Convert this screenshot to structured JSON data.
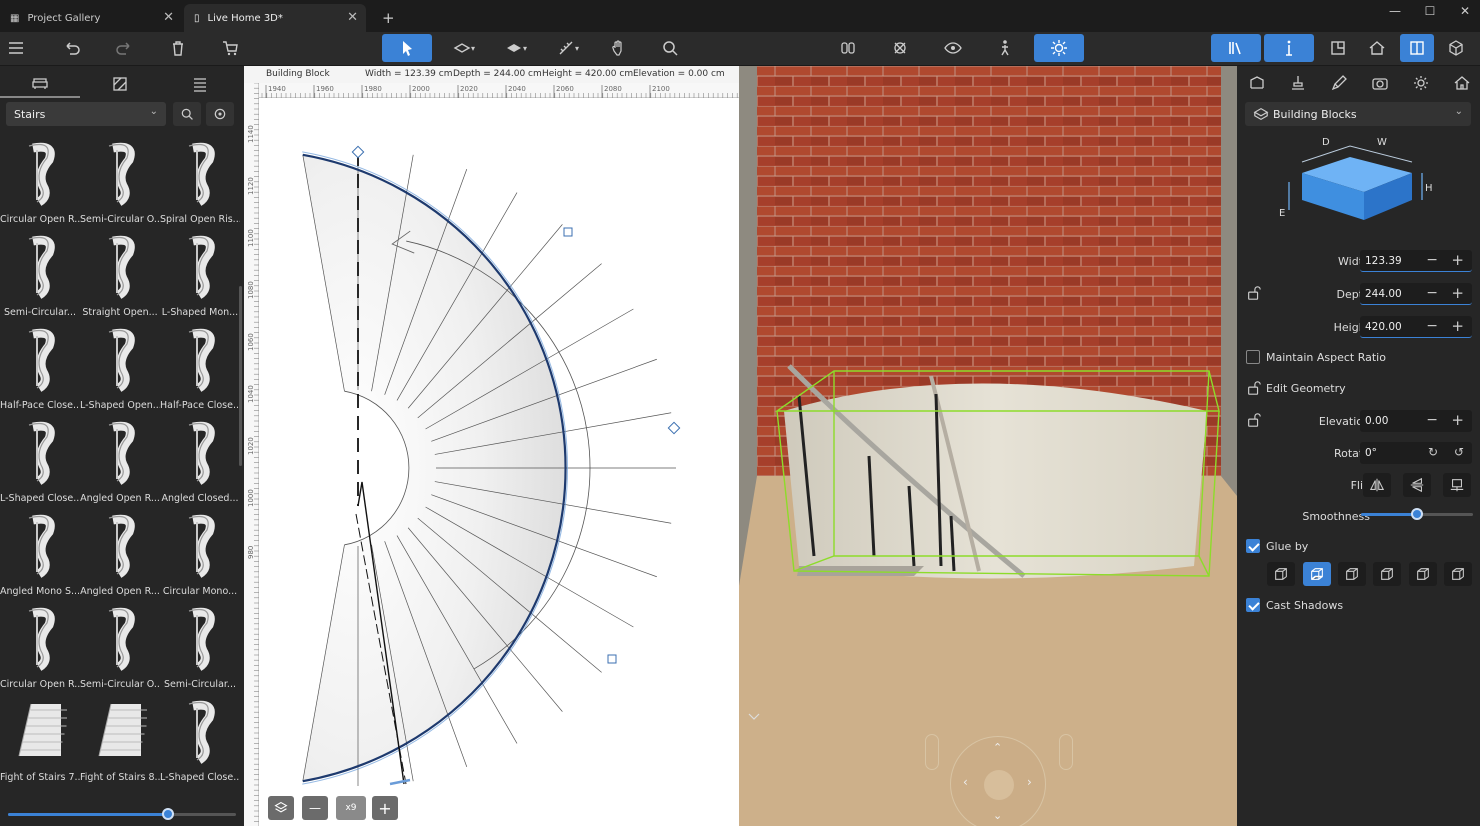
{
  "tabs": [
    {
      "label": "Project Gallery"
    },
    {
      "label": "Live Home 3D*"
    }
  ],
  "left": {
    "category": "Stairs",
    "items": [
      {
        "label": "Circular Open R..."
      },
      {
        "label": "Semi-Circular O..."
      },
      {
        "label": "Spiral Open Ris..."
      },
      {
        "label": "Semi-Circular..."
      },
      {
        "label": "Straight Open..."
      },
      {
        "label": "L-Shaped Mon..."
      },
      {
        "label": "Half-Pace Close..."
      },
      {
        "label": "L-Shaped Open..."
      },
      {
        "label": "Half-Pace Close..."
      },
      {
        "label": "L-Shaped Close..."
      },
      {
        "label": "Angled Open R..."
      },
      {
        "label": "Angled Closed..."
      },
      {
        "label": "Angled Mono S..."
      },
      {
        "label": "Angled Open R..."
      },
      {
        "label": "Circular Mono..."
      },
      {
        "label": "Circular Open R..."
      },
      {
        "label": "Semi-Circular O..."
      },
      {
        "label": "Semi-Circular..."
      },
      {
        "label": "Fight of Stairs 7..."
      },
      {
        "label": "Fight of Stairs 8..."
      },
      {
        "label": "L-Shaped Close..."
      }
    ],
    "zoom_level": 0.7
  },
  "plan": {
    "object": "Building Block",
    "width": "Width = 123.39 cm",
    "depth": "Depth = 244.00 cm",
    "height": "Height = 420.00 cm",
    "elevation": "Elevation = 0.00 cm",
    "ruler_top": [
      "1940",
      "1960",
      "1980",
      "2000",
      "2020",
      "2040",
      "2060",
      "2080",
      "2100"
    ],
    "ruler_left": [
      "1140",
      "1120",
      "1100",
      "1080",
      "1060",
      "1040",
      "1020",
      "1000",
      "980"
    ],
    "ruler_unit": "cm",
    "zoom_label": "x9"
  },
  "right": {
    "section": "Building Blocks",
    "dims": {
      "d": "D",
      "w": "W",
      "h": "H",
      "e": "E"
    },
    "width_label": "Width",
    "width": "123.39",
    "depth_label": "Depth",
    "depth": "244.00",
    "height_label": "Height",
    "height": "420.00",
    "maintain_label": "Maintain Aspect Ratio",
    "edit_label": "Edit Geometry",
    "elevation_label": "Elevation",
    "elevation": "0.00",
    "rotate_label": "Rotate",
    "rotate": "0°",
    "flip_label": "Flip",
    "smooth_label": "Smoothness",
    "smoothness": 0.5,
    "glue_label": "Glue by",
    "shadow_label": "Cast Shadows"
  },
  "colors": {
    "accent": "#3b82d6",
    "brick": "#9e3b2a",
    "floor": "#c8a77a"
  }
}
